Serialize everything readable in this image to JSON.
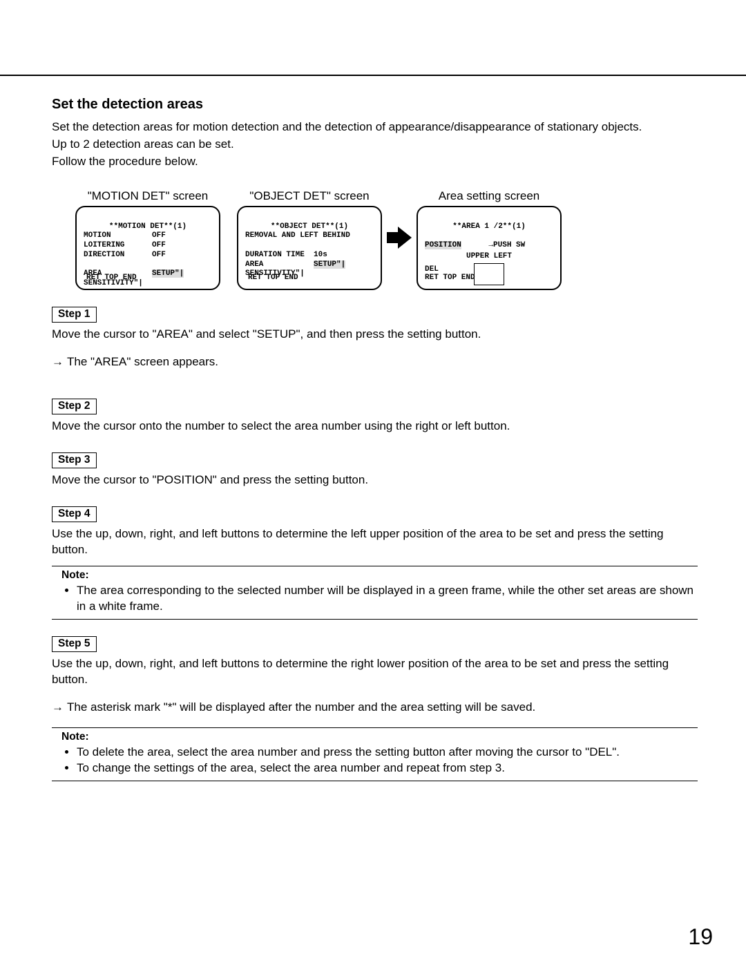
{
  "heading": "Set the detection areas",
  "intro": [
    "Set the detection areas for motion detection and the detection of appearance/disappearance of stationary objects.",
    "Up to 2 detection areas can be set.",
    "Follow the procedure below."
  ],
  "screens": {
    "motion": {
      "label": "\"MOTION DET\" screen",
      "title": "**MOTION DET**(1)",
      "rows": [
        [
          "MOTION",
          "OFF"
        ],
        [
          "LOITERING",
          "OFF"
        ],
        [
          "DIRECTION",
          "OFF"
        ],
        [
          "",
          ""
        ],
        [
          "AREA",
          "SETUP\"|"
        ],
        [
          "SENSITIVITY\"|",
          ""
        ]
      ],
      "footer": "RET TOP END"
    },
    "object": {
      "label": "\"OBJECT DET\" screen",
      "title": "**OBJECT DET**(1)",
      "sub": "REMOVAL AND LEFT BEHIND",
      "rows": [
        [
          "DURATION TIME",
          "10s"
        ],
        [
          "AREA",
          "SETUP\"|"
        ],
        [
          "SENSITIVITY\"|",
          ""
        ]
      ],
      "footer": "RET TOP END"
    },
    "area": {
      "label": "Area setting screen",
      "title": "**AREA 1 /2**(1)",
      "position_label": "POSITION",
      "position_value": "→PUSH SW",
      "caption": "UPPER LEFT",
      "del": "DEL",
      "footer": "RET TOP END"
    }
  },
  "steps": {
    "s1": {
      "label": "Step 1",
      "body": "Move the cursor to \"AREA\" and select \"SETUP\", and then press the setting button.",
      "result": "The \"AREA\" screen appears."
    },
    "s2": {
      "label": "Step 2",
      "body": "Move the cursor onto the number to select the area number using the right or left button."
    },
    "s3": {
      "label": "Step 3",
      "body": "Move the cursor to \"POSITION\" and press the setting button."
    },
    "s4": {
      "label": "Step 4",
      "body": "Use the up, down, right, and left buttons to determine the left upper position of the area to be set and press the setting button."
    },
    "s5": {
      "label": "Step 5",
      "body": "Use the up, down, right, and left buttons to determine the right lower position of the area to be set and press the setting button.",
      "result": "The asterisk mark \"*\" will be displayed after the number and the area setting will be saved."
    }
  },
  "notes": {
    "n1": {
      "title": "Note:",
      "items": [
        "The area corresponding to the selected number will be displayed in a green frame, while the other set areas are shown in a white frame."
      ]
    },
    "n2": {
      "title": "Note:",
      "items": [
        "To delete the area, select the area number and press the setting button after moving the cursor to \"DEL\".",
        "To change the settings of the area, select the area number and repeat from step 3."
      ]
    }
  },
  "page_number": "19"
}
